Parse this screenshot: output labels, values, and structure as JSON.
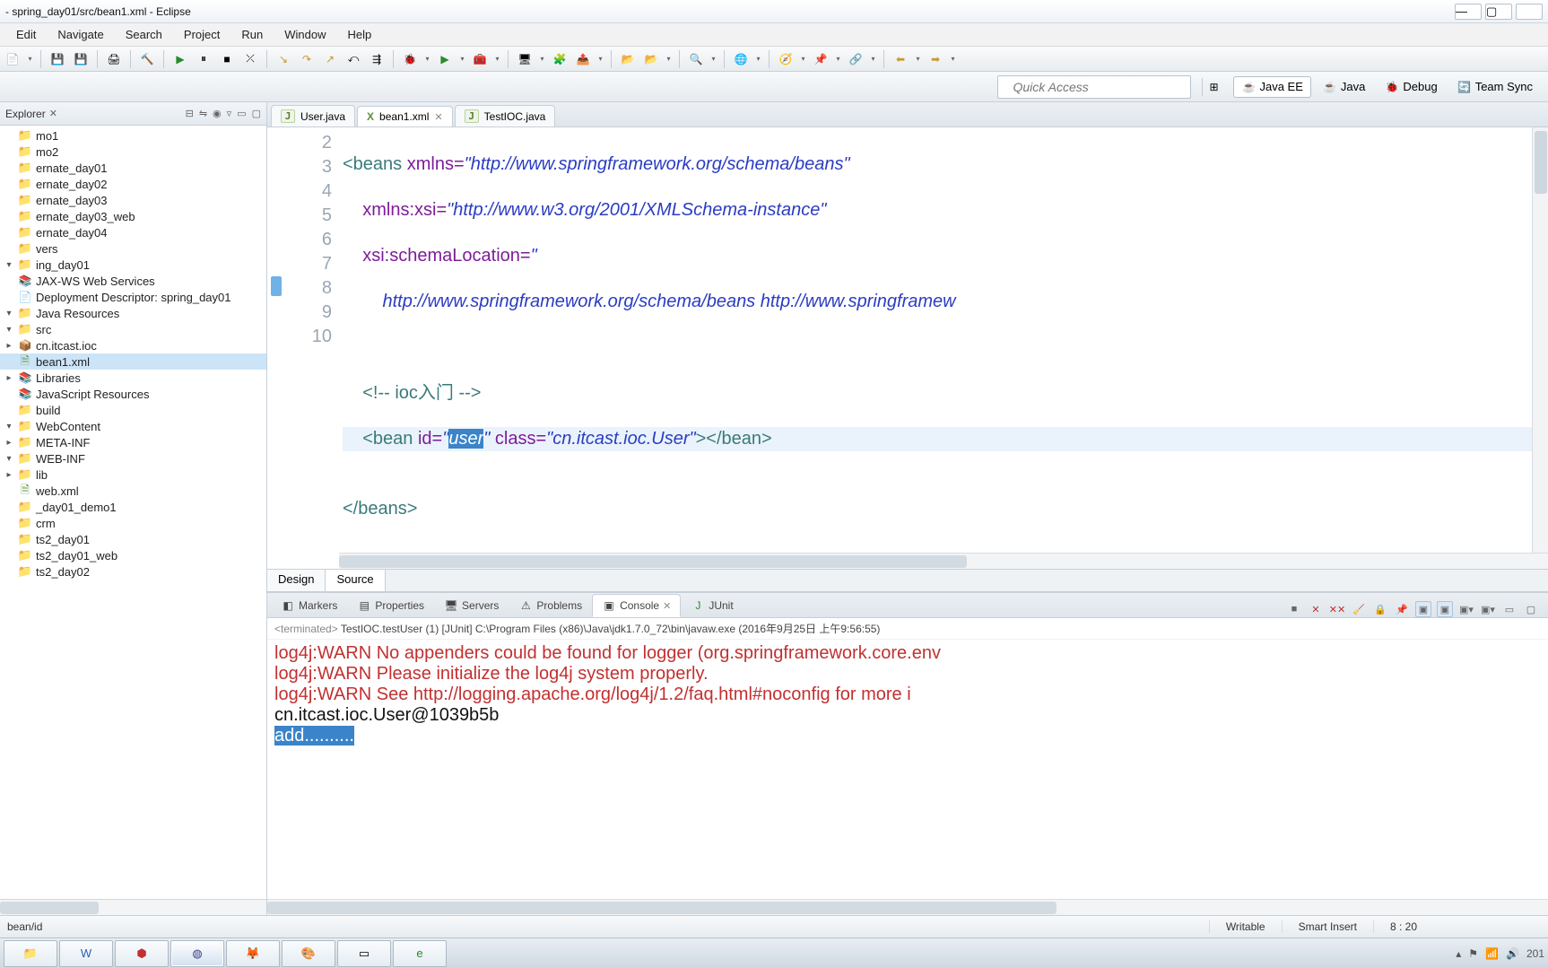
{
  "title": "- spring_day01/src/bean1.xml - Eclipse",
  "menu": [
    "Edit",
    "Navigate",
    "Search",
    "Project",
    "Run",
    "Window",
    "Help"
  ],
  "quick_access": "Quick Access",
  "perspectives": [
    {
      "icon": "☕",
      "label": "Java EE",
      "active": true
    },
    {
      "icon": "☕",
      "label": "Java",
      "active": false
    },
    {
      "icon": "🐞",
      "label": "Debug",
      "active": false
    },
    {
      "icon": "🔄",
      "label": "Team Sync",
      "active": false
    }
  ],
  "explorer": {
    "title": "Explorer",
    "items": [
      {
        "label": "mo1",
        "indent": 1,
        "icon": "folder"
      },
      {
        "label": "mo2",
        "indent": 1,
        "icon": "folder"
      },
      {
        "label": "ernate_day01",
        "indent": 1,
        "icon": "folder"
      },
      {
        "label": "ernate_day02",
        "indent": 1,
        "icon": "folder"
      },
      {
        "label": "ernate_day03",
        "indent": 1,
        "icon": "folder"
      },
      {
        "label": "ernate_day03_web",
        "indent": 1,
        "icon": "folder"
      },
      {
        "label": "ernate_day04",
        "indent": 1,
        "icon": "folder"
      },
      {
        "label": "vers",
        "indent": 1,
        "icon": "folder"
      },
      {
        "label": "ing_day01",
        "indent": 1,
        "icon": "folder",
        "expanded": true
      },
      {
        "label": "JAX-WS Web Services",
        "indent": 2,
        "icon": "lib"
      },
      {
        "label": "Deployment Descriptor: spring_day01",
        "indent": 2,
        "icon": "file"
      },
      {
        "label": "Java Resources",
        "indent": 2,
        "icon": "folder",
        "expanded": true
      },
      {
        "label": "src",
        "indent": 3,
        "icon": "folder",
        "expanded": true
      },
      {
        "label": "cn.itcast.ioc",
        "indent": 4,
        "icon": "pkg",
        "expander": "▸"
      },
      {
        "label": "bean1.xml",
        "indent": 4,
        "icon": "xml",
        "selected": true
      },
      {
        "label": "Libraries",
        "indent": 3,
        "icon": "lib",
        "expander": "▸"
      },
      {
        "label": "JavaScript Resources",
        "indent": 2,
        "icon": "lib"
      },
      {
        "label": "build",
        "indent": 2,
        "icon": "folder"
      },
      {
        "label": "WebContent",
        "indent": 2,
        "icon": "folder",
        "expanded": true
      },
      {
        "label": "META-INF",
        "indent": 3,
        "icon": "folder",
        "expander": "▸"
      },
      {
        "label": "WEB-INF",
        "indent": 3,
        "icon": "folder",
        "expanded": true
      },
      {
        "label": "lib",
        "indent": 4,
        "icon": "folder",
        "expander": "▸"
      },
      {
        "label": "web.xml",
        "indent": 4,
        "icon": "xml"
      },
      {
        "label": "_day01_demo1",
        "indent": 1,
        "icon": "folder"
      },
      {
        "label": "crm",
        "indent": 1,
        "icon": "folder"
      },
      {
        "label": "ts2_day01",
        "indent": 1,
        "icon": "folder"
      },
      {
        "label": "ts2_day01_web",
        "indent": 1,
        "icon": "folder"
      },
      {
        "label": "ts2_day02",
        "indent": 1,
        "icon": "folder"
      }
    ]
  },
  "editor": {
    "tabs": [
      {
        "label": "User.java",
        "icon": "J",
        "active": false
      },
      {
        "label": "bean1.xml",
        "icon": "X",
        "active": true
      },
      {
        "label": "TestIOC.java",
        "icon": "J",
        "active": false
      }
    ],
    "lines": [
      "2",
      "3",
      "4",
      "5",
      "6",
      "7",
      "8",
      "9",
      "10"
    ],
    "design_tab": "Design",
    "source_tab": "Source",
    "code": {
      "l2_pre": "<beans ",
      "l2_attr": "xmlns=",
      "l2_str": "\"http://www.springframework.org/schema/beans\"",
      "l3_attr": "xmlns:xsi=",
      "l3_str": "\"http://www.w3.org/2001/XMLSchema-instance\"",
      "l4_attr": "xsi:schemaLocation=",
      "l4_str": "\"",
      "l5_str": "http://www.springframework.org/schema/beans http://www.springframew",
      "l7_comment": "<!-- ioc入门 -->",
      "l8_open": "<bean ",
      "l8_idattr": "id=",
      "l8_q1": "\"",
      "l8_sel": "user",
      "l8_q2": "\"",
      "l8_classattr": " class=",
      "l8_classval": "\"cn.itcast.ioc.User\"",
      "l8_close": "></bean>",
      "l10": "</beans>"
    }
  },
  "views": {
    "tabs": [
      "Markers",
      "Properties",
      "Servers",
      "Problems",
      "Console",
      "JUnit"
    ],
    "active": "Console",
    "meta_term": "<terminated>",
    "meta_rest": " TestIOC.testUser (1) [JUnit] C:\\Program Files (x86)\\Java\\jdk1.7.0_72\\bin\\javaw.exe (2016年9月25日 上午9:56:55)",
    "lines": {
      "w1": "log4j:WARN No appenders could be found for logger (org.springframework.core.env",
      "w2": "log4j:WARN Please initialize the log4j system properly.",
      "w3": "log4j:WARN See http://logging.apache.org/log4j/1.2/faq.html#noconfig for more i",
      "o1": "cn.itcast.ioc.User@1039b5b",
      "h1": "add.........."
    }
  },
  "status": {
    "path": "bean/id",
    "writable": "Writable",
    "insert": "Smart Insert",
    "pos": "8 : 20"
  },
  "tray_time": "201"
}
